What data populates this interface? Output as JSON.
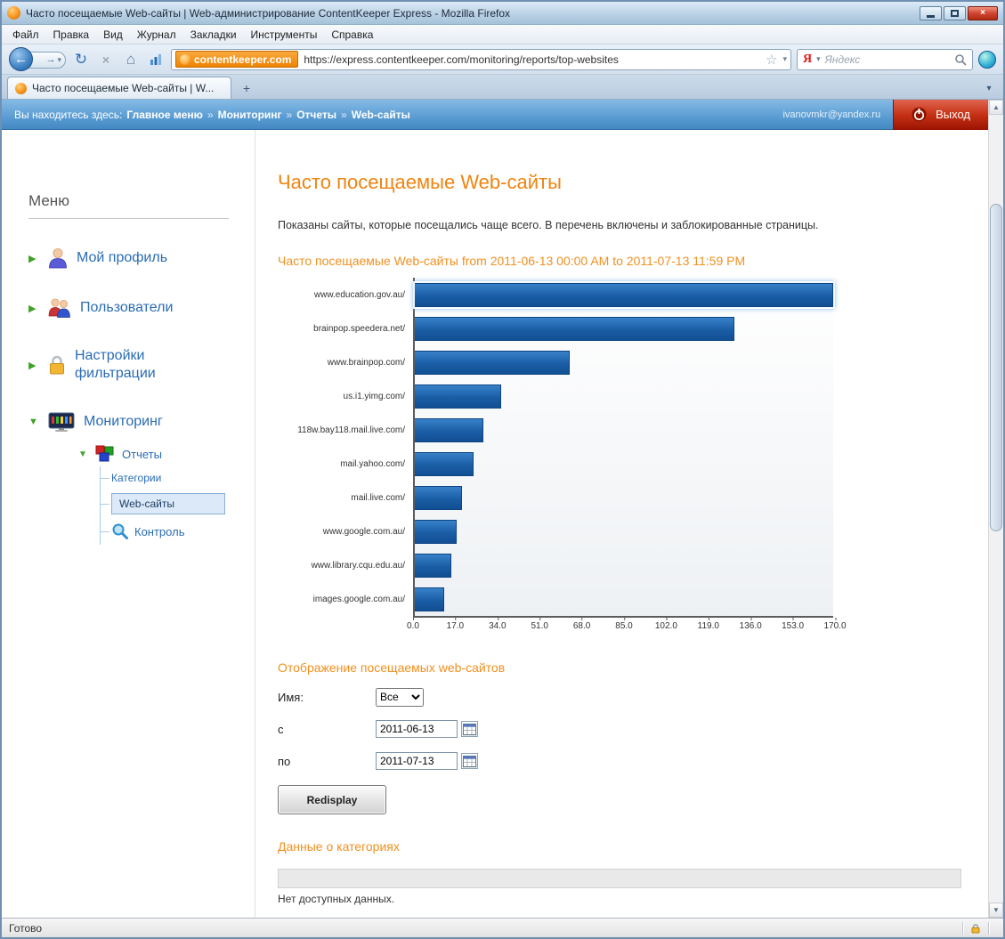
{
  "window": {
    "title": "Часто посещаемые Web-сайты | Web-администрирование ContentKeeper Express - Mozilla Firefox"
  },
  "menubar": {
    "items": [
      "Файл",
      "Правка",
      "Вид",
      "Журнал",
      "Закладки",
      "Инструменты",
      "Справка"
    ]
  },
  "navbar": {
    "domain_button": "contentkeeper.com",
    "url": "https://express.contentkeeper.com/monitoring/reports/top-websites",
    "search_placeholder": "Яндекс"
  },
  "tabs": {
    "active_label": "Часто посещаемые Web-сайты | W...",
    "new_tab": "+"
  },
  "breadcrumb": {
    "prefix": "Вы находитесь здесь:",
    "items": [
      "Главное меню",
      "Мониторинг",
      "Отчеты",
      "Web-сайты"
    ],
    "separator": "»",
    "user_email": "ivanovmkr@yandex.ru",
    "logout_label": "Выход"
  },
  "sidebar": {
    "title": "Меню",
    "items": [
      {
        "label": "Мой профиль"
      },
      {
        "label": "Пользователи"
      },
      {
        "label": "Настройки фильтрации"
      },
      {
        "label": "Мониторинг"
      },
      {
        "label": "Отчеты"
      },
      {
        "label": "Категории"
      },
      {
        "label": "Web-сайты"
      },
      {
        "label": "Контроль"
      }
    ]
  },
  "main": {
    "page_title": "Часто посещаемые Web-сайты",
    "description": "Показаны сайты, которые посещались чаще всего. В перечень включены и заблокированные страницы.",
    "filter_section_title": "Отображение посещаемых web-сайтов",
    "form": {
      "name_label": "Имя:",
      "name_value": "Все",
      "from_label": "с",
      "from_value": "2011-06-13",
      "to_label": "по",
      "to_value": "2011-07-13",
      "redisplay_label": "Redisplay"
    },
    "categories_section_title": "Данные о категориях",
    "no_data_text": "Нет доступных данных."
  },
  "chart_data": {
    "type": "bar",
    "orientation": "horizontal",
    "title": "Часто посещаемые Web-сайты from 2011-06-13 00:00 AM to 2011-07-13 11:59 PM",
    "categories": [
      "www.education.gov.au/",
      "brainpop.speedera.net/",
      "www.brainpop.com/",
      "us.i1.yimg.com/",
      "118w.bay118.mail.live.com/",
      "mail.yahoo.com/",
      "mail.live.com/",
      "www.google.com.au/",
      "www.library.cqu.edu.au/",
      "images.google.com.au/"
    ],
    "values": [
      170,
      130,
      63,
      35,
      28,
      24,
      19,
      17,
      15,
      12
    ],
    "xlim": [
      0,
      170
    ],
    "x_ticks": [
      "0.0",
      "17.0",
      "34.0",
      "51.0",
      "68.0",
      "85.0",
      "102.0",
      "119.0",
      "136.0",
      "153.0",
      "170.0"
    ],
    "bar_color": "#1a5da5",
    "grid": false,
    "legend": false
  },
  "statusbar": {
    "text": "Готово"
  },
  "colors": {
    "accent_orange": "#ef8410",
    "link_blue": "#2a6cb5",
    "logout_red": "#c53114",
    "crumb_blue": "#5397cf"
  },
  "icons": {
    "back": "←",
    "forward": "→",
    "reload": "↻",
    "stop": "×",
    "home": "⌂",
    "star": "☆",
    "caret": "▾",
    "tab_list": "▾",
    "scroll_up": "▲",
    "scroll_down": "▼",
    "menu_collapsed": "▶",
    "menu_expanded": "▼",
    "yandex_logo": "Я",
    "close": "×"
  }
}
